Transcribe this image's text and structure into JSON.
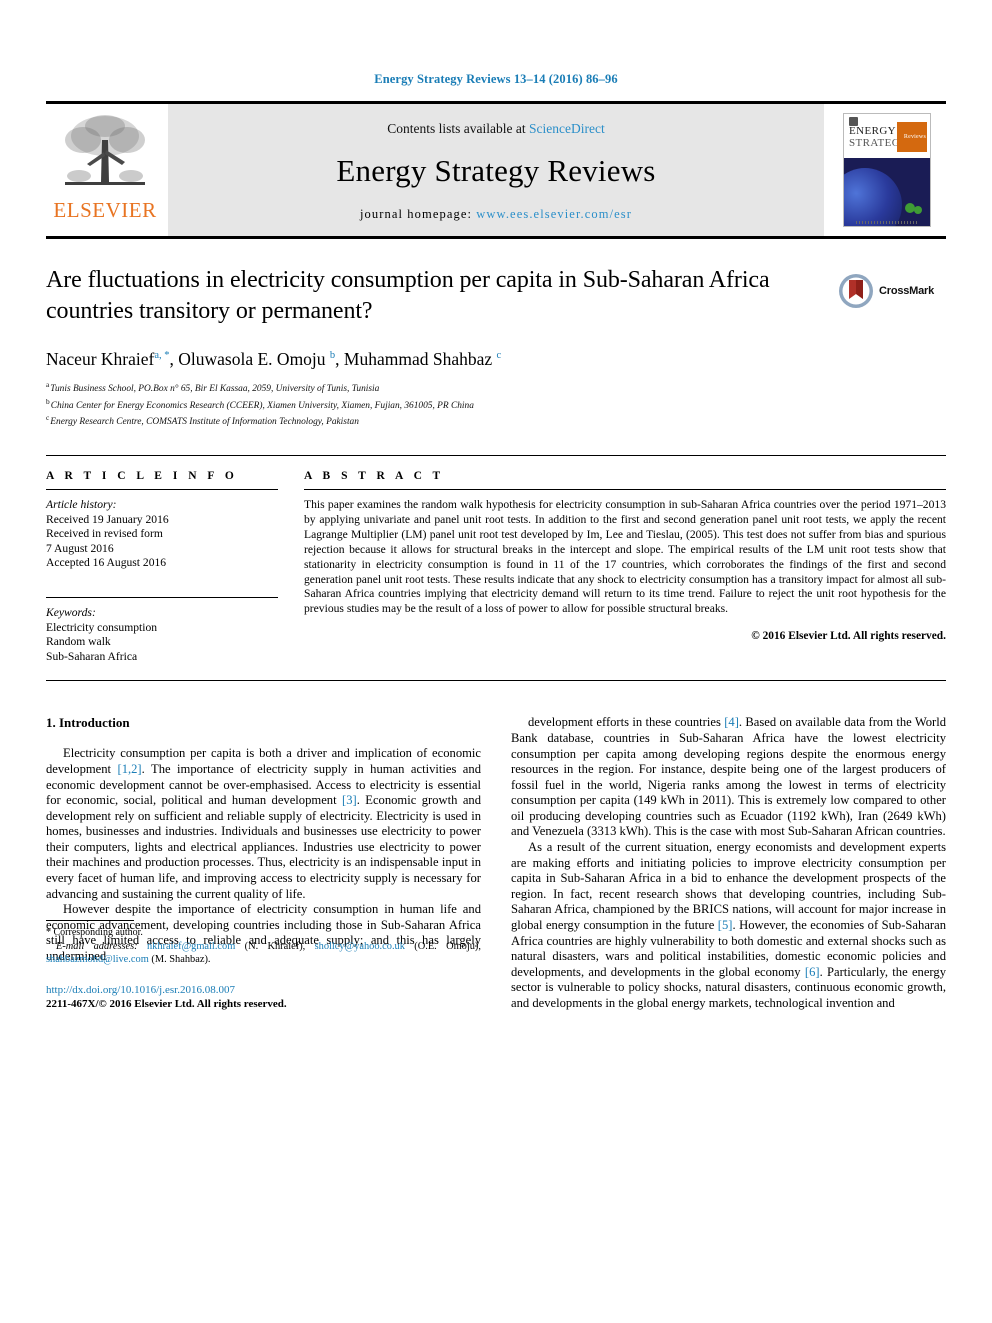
{
  "running_head": "Energy Strategy Reviews 13–14 (2016) 86–96",
  "masthead": {
    "contents_prefix": "Contents lists available at ",
    "sciencedirect": "ScienceDirect",
    "journal_name": "Energy Strategy Reviews",
    "homepage_prefix": "journal homepage: ",
    "homepage_url": "www.ees.elsevier.com/esr",
    "publisher": "ELSEVIER",
    "cover": {
      "line1": "ENERGY",
      "line2": "STRATEGY",
      "badge": "Reviews"
    }
  },
  "article": {
    "title": "Are fluctuations in electricity consumption per capita in Sub-Saharan Africa countries transitory or permanent?",
    "crossmark_label": "CrossMark",
    "authors": [
      {
        "name": "Naceur Khraief",
        "marks": "a, *"
      },
      {
        "name": "Oluwasola E. Omoju",
        "marks": "b"
      },
      {
        "name": "Muhammad Shahbaz",
        "marks": "c"
      }
    ],
    "affiliations": [
      {
        "mark": "a",
        "text": "Tunis Business School, PO.Box n° 65, Bir El Kassaa, 2059, University of Tunis, Tunisia"
      },
      {
        "mark": "b",
        "text": "China Center for Energy Economics Research (CCEER), Xiamen University, Xiamen, Fujian, 361005, PR China"
      },
      {
        "mark": "c",
        "text": "Energy Research Centre, COMSATS Institute of Information Technology, Pakistan"
      }
    ]
  },
  "article_info": {
    "heading": "A R T I C L E   I N F O",
    "history_label": "Article history:",
    "history": [
      "Received 19 January 2016",
      "Received in revised form",
      "7 August 2016",
      "Accepted 16 August 2016"
    ],
    "keywords_label": "Keywords:",
    "keywords": [
      "Electricity consumption",
      "Random walk",
      "Sub-Saharan Africa"
    ]
  },
  "abstract": {
    "heading": "A B S T R A C T",
    "text": "This paper examines the random walk hypothesis for electricity consumption in sub-Saharan Africa countries over the period 1971–2013 by applying univariate and panel unit root tests. In addition to the first and second generation panel unit root tests, we apply the recent Lagrange Multiplier (LM) panel unit root test developed by Im, Lee and Tieslau, (2005). This test does not suffer from bias and spurious rejection because it allows for structural breaks in the intercept and slope. The empirical results of the LM unit root tests show that stationarity in electricity consumption is found in 11 of the 17 countries, which corroborates the findings of the first and second generation panel unit root tests. These results indicate that any shock to electricity consumption has a transitory impact for almost all sub-Saharan Africa countries implying that electricity demand will return to its time trend. Failure to reject the unit root hypothesis for the previous studies may be the result of a loss of power to allow for possible structural breaks.",
    "copyright": "© 2016 Elsevier Ltd. All rights reserved."
  },
  "body": {
    "section_title": "1. Introduction",
    "left_paragraphs": [
      "Electricity consumption per capita is both a driver and implication of economic development [1,2]. The importance of electricity supply in human activities and economic development cannot be over-emphasised. Access to electricity is essential for economic, social, political and human development [3]. Economic growth and development rely on sufficient and reliable supply of electricity. Electricity is used in homes, businesses and industries. Individuals and businesses use electricity to power their computers, lights and electrical appliances. Industries use electricity to power their machines and production processes. Thus, electricity is an indispensable input in every facet of human life, and improving access to electricity supply is necessary for advancing and sustaining the current quality of life.",
      "However despite the importance of electricity consumption in human life and economic advancement, developing countries including those in Sub-Saharan Africa still have limited access to reliable and adequate supply; and this has largely undermined"
    ],
    "right_paragraphs": [
      "development efforts in these countries [4]. Based on available data from the World Bank database, countries in Sub-Saharan Africa have the lowest electricity consumption per capita among developing regions despite the enormous energy resources in the region. For instance, despite being one of the largest producers of fossil fuel in the world, Nigeria ranks among the lowest in terms of electricity consumption per capita (149 kWh in 2011). This is extremely low compared to other oil producing developing countries such as Ecuador (1192 kWh), Iran (2649 kWh) and Venezuela (3313 kWh). This is the case with most Sub-Saharan African countries.",
      "As a result of the current situation, energy economists and development experts are making efforts and initiating policies to improve electricity consumption per capita in Sub-Saharan Africa in a bid to enhance the development prospects of the region. In fact, recent research shows that developing countries, including Sub-Saharan Africa, championed by the BRICS nations, will account for major increase in global energy consumption in the future [5]. However, the economies of Sub-Saharan Africa countries are highly vulnerability to both domestic and external shocks such as natural disasters, wars and political instabilities, domestic economic policies and developments, and developments in the global economy [6]. Particularly, the energy sector is vulnerable to policy shocks, natural disasters, continuous economic growth, and developments in the global energy markets, technological invention and"
    ]
  },
  "footnote": {
    "corresponding": "* Corresponding author.",
    "email_label": "E-mail addresses:",
    "emails": [
      {
        "address": "nkhraief@gmail.com",
        "owner": "(N. Khraief)"
      },
      {
        "address": "shollcy@yahoo.co.uk",
        "owner": "(O.E. Omoju)"
      },
      {
        "address": "shahbazmohd@live.com",
        "owner": "(M. Shahbaz)"
      }
    ],
    "doi": "http://dx.doi.org/10.1016/j.esr.2016.08.007",
    "issn": "2211-467X/© 2016 Elsevier Ltd. All rights reserved."
  },
  "colors": {
    "link_blue": "#1a7db6",
    "elsevier_orange": "#e87422",
    "cover_orange": "#d4690f",
    "cover_blue": "#1a1c55",
    "crossmark_red": "#b03028"
  }
}
